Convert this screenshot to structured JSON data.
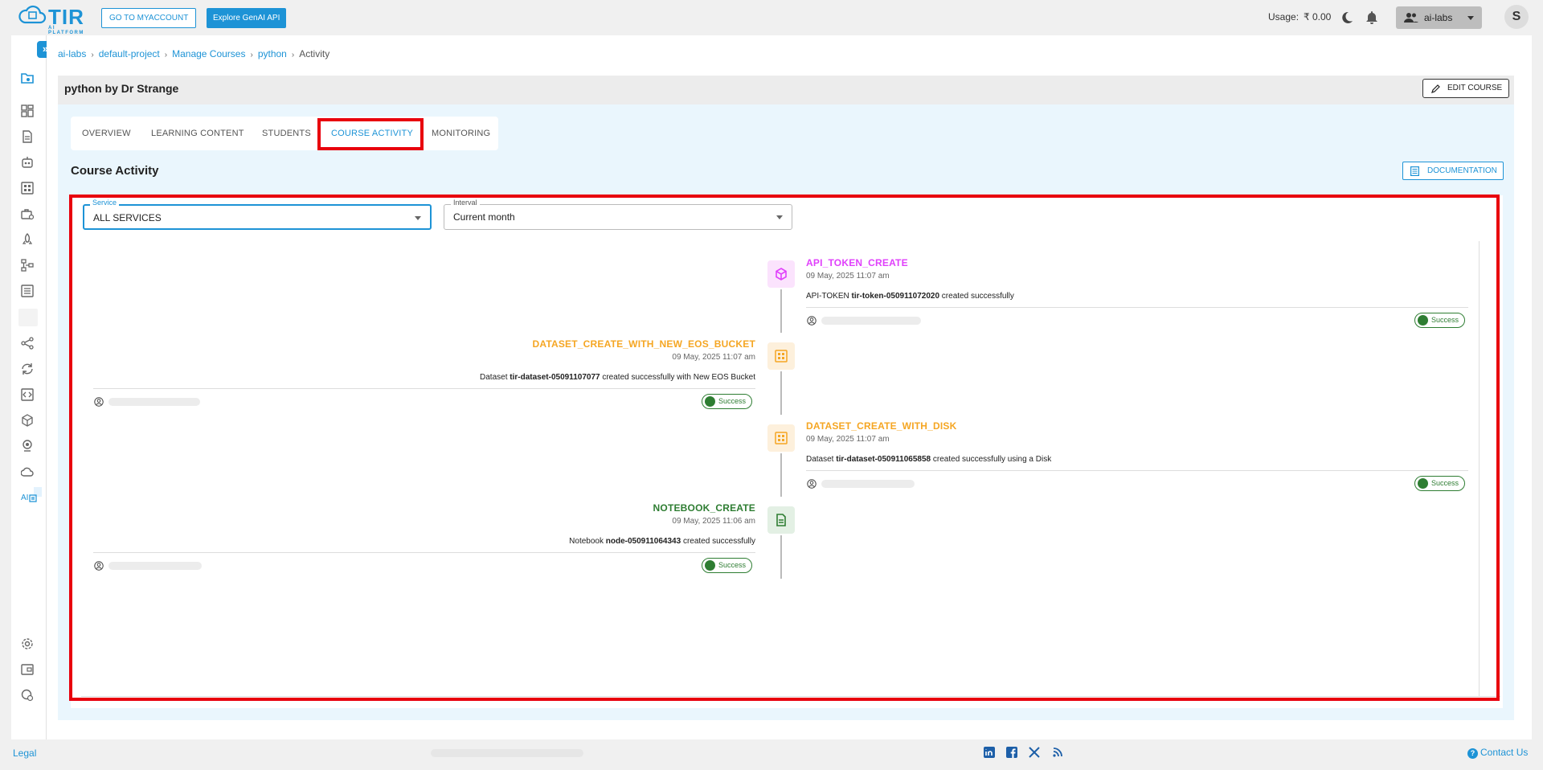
{
  "header": {
    "logo_text": "TIR",
    "logo_subtitle": "AI PLATFORM",
    "myaccount_label": "GO TO MYACCOUNT",
    "genai_label": "Explore GenAI API",
    "usage_label": "Usage:",
    "usage_value": "₹ 0.00",
    "workspace_label": "ai-labs",
    "avatar_letter": "S"
  },
  "sidebar": {
    "expand_label": "»",
    "truncated_label": "AI",
    "icons": [
      "folder-icon",
      "dashboard-icon",
      "document-icon",
      "robot-icon",
      "grid-icon",
      "briefcase-icon",
      "rocket-icon",
      "pipeline-icon",
      "list-icon",
      "blank-icon",
      "share-icon",
      "sync-icon",
      "code-icon",
      "cube-icon",
      "badge-icon",
      "cloud-icon",
      "settings-icon",
      "wallet-icon",
      "support-icon"
    ]
  },
  "breadcrumb": [
    "ai-labs",
    "default-project",
    "Manage Courses",
    "python",
    "Activity"
  ],
  "course": {
    "title": "python by Dr Strange",
    "edit_label": "EDIT COURSE"
  },
  "tabs": [
    {
      "label": "OVERVIEW",
      "active": false
    },
    {
      "label": "LEARNING CONTENT",
      "active": false
    },
    {
      "label": "STUDENTS",
      "active": false
    },
    {
      "label": "COURSE ACTIVITY",
      "active": true
    },
    {
      "label": "MONITORING",
      "active": false
    }
  ],
  "section": {
    "title": "Course Activity",
    "doc_label": "DOCUMENTATION"
  },
  "filters": {
    "service_label": "Service",
    "service_value": "ALL SERVICES",
    "interval_label": "Interval",
    "interval_value": "Current month"
  },
  "events": [
    {
      "title": "API_TOKEN_CREATE",
      "date": "09 May, 2025 11:07 am",
      "msg_prefix": "API-TOKEN ",
      "msg_bold": "tir-token-050911072020",
      "msg_suffix": " created successfully",
      "status": "Success",
      "color": "#e040fb",
      "icon": "cube-icon"
    },
    {
      "title": "DATASET_CREATE_WITH_NEW_EOS_BUCKET",
      "date": "09 May, 2025 11:07 am",
      "msg_prefix": "Dataset ",
      "msg_bold": "tir-dataset-05091107077",
      "msg_suffix": " created successfully with New EOS Bucket",
      "status": "Success",
      "color": "#f5a623",
      "icon": "grid-icon"
    },
    {
      "title": "DATASET_CREATE_WITH_DISK",
      "date": "09 May, 2025 11:07 am",
      "msg_prefix": "Dataset ",
      "msg_bold": "tir-dataset-050911065858",
      "msg_suffix": " created successfully using a Disk",
      "status": "Success",
      "color": "#f5a623",
      "icon": "grid-icon"
    },
    {
      "title": "NOTEBOOK_CREATE",
      "date": "09 May, 2025 11:06 am",
      "msg_prefix": "Notebook ",
      "msg_bold": "node-050911064343",
      "msg_suffix": " created successfully",
      "status": "Success",
      "color": "#2e7d32",
      "icon": "notebook-icon"
    }
  ],
  "footer": {
    "legal_label": "Legal",
    "contact_label": "Contact Us",
    "social_icons": [
      "linkedin-icon",
      "facebook-icon",
      "x-icon",
      "rss-icon"
    ]
  }
}
